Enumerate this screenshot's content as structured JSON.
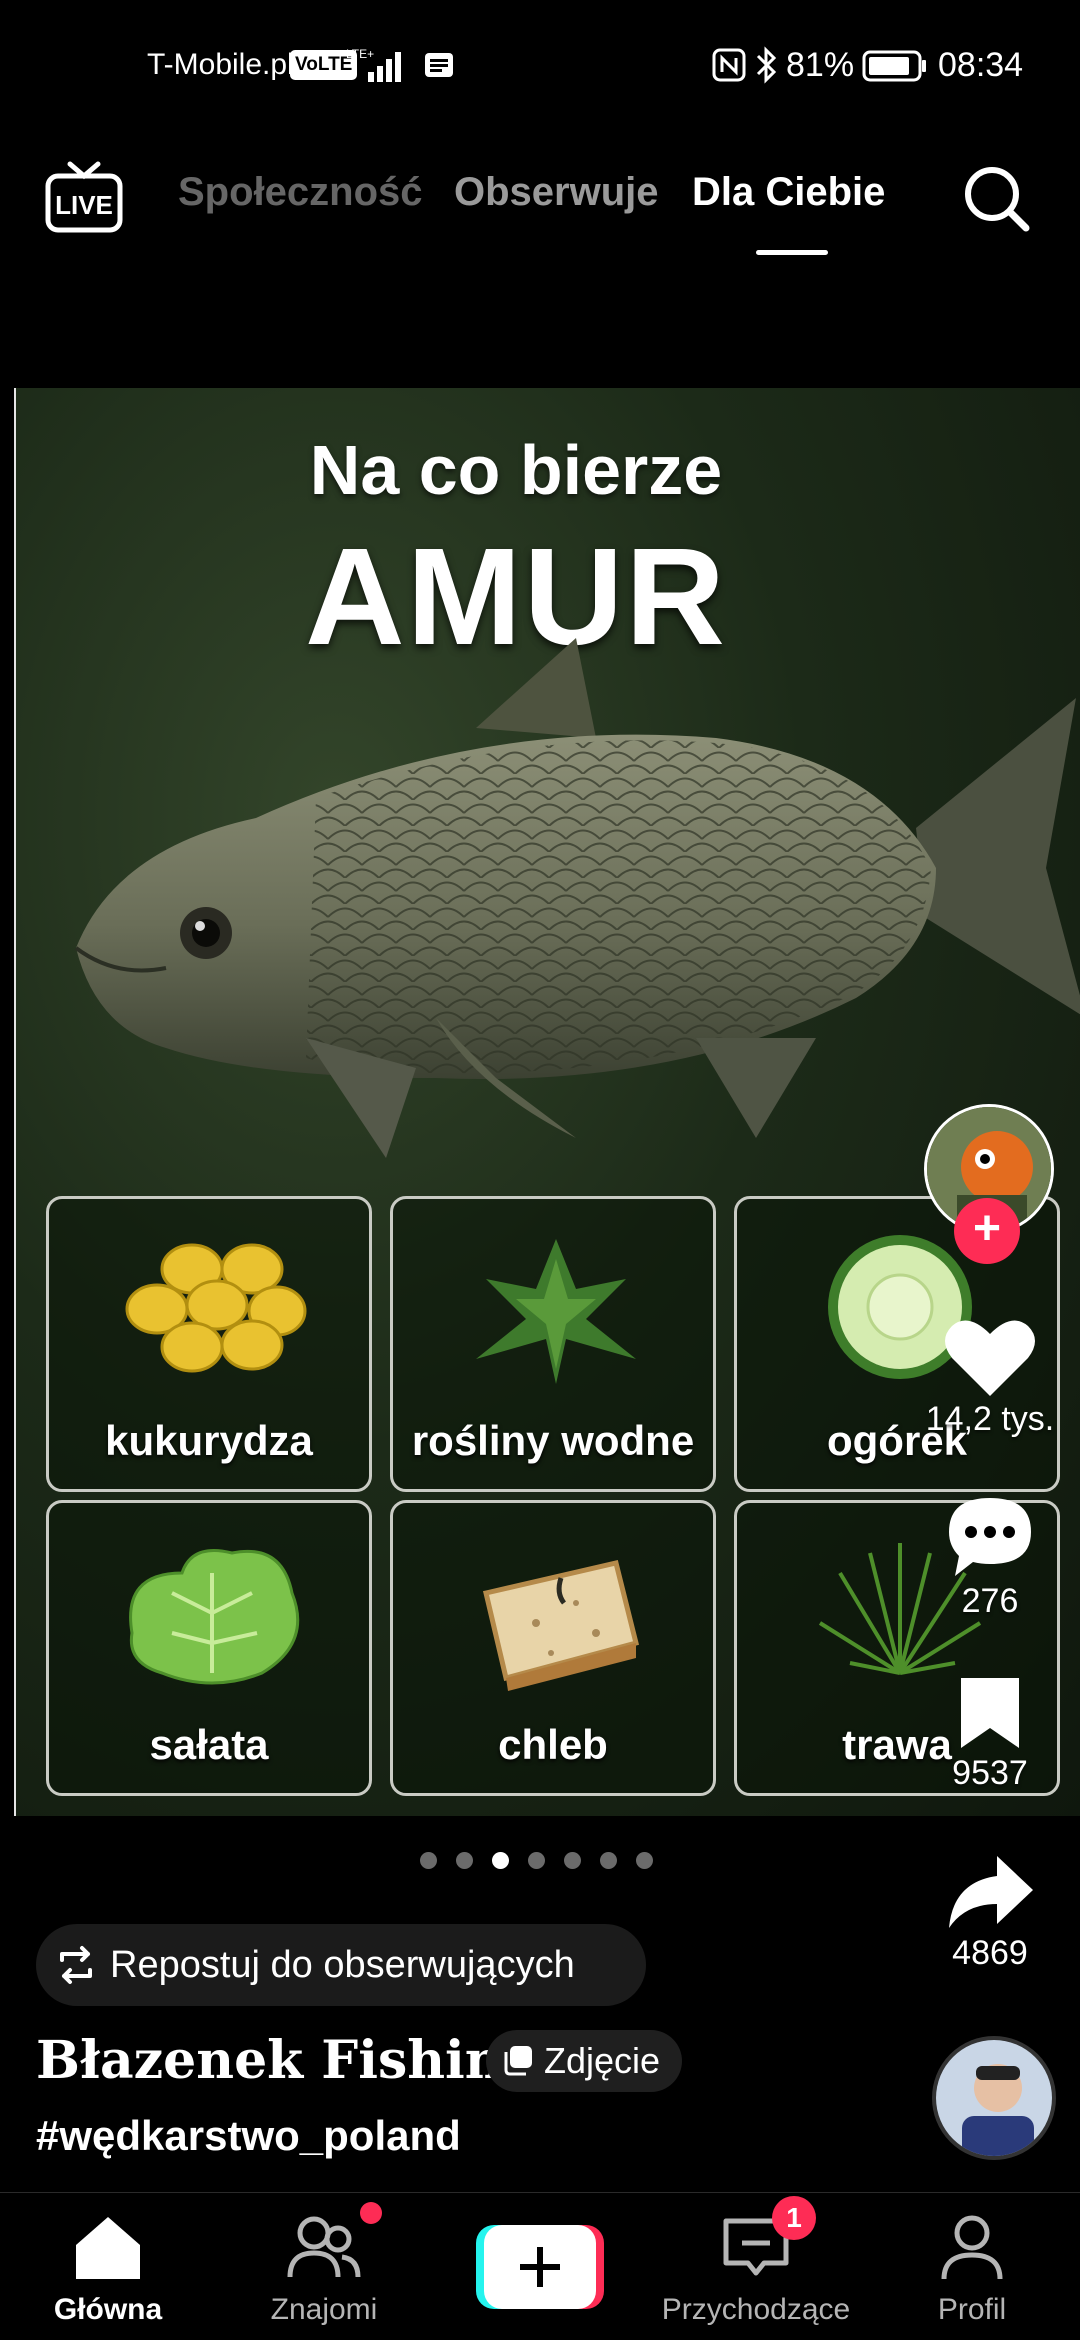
{
  "status_bar": {
    "carrier": "T-Mobile.pl",
    "volte": "VoLTE",
    "network": "LTE+",
    "battery": "81%",
    "time": "08:34"
  },
  "top_nav": {
    "tabs": [
      {
        "label": "Społeczność",
        "active": false
      },
      {
        "label": "Obserwuje",
        "active": false
      },
      {
        "label": "Dla Ciebie",
        "active": true
      }
    ]
  },
  "post": {
    "image": {
      "subtitle": "Na co bierze",
      "title": "AMUR",
      "baits": [
        {
          "label": "kukurydza",
          "icon": "corn-icon"
        },
        {
          "label": "rośliny wodne",
          "icon": "water-plants-icon"
        },
        {
          "label": "ogórek",
          "icon": "cucumber-icon"
        },
        {
          "label": "sałata",
          "icon": "lettuce-icon"
        },
        {
          "label": "chleb",
          "icon": "bread-icon"
        },
        {
          "label": "trawa",
          "icon": "grass-icon"
        }
      ]
    },
    "carousel": {
      "count": 7,
      "active_index": 2
    },
    "likes": "14,2 tys.",
    "comments": "276",
    "saves": "9537",
    "shares": "4869",
    "repost_label": "Repostuj do obserwujących",
    "author": "Błazenek Fishing",
    "badge": "Zdjęcie",
    "hashtag": "#wędkarstwo_poland"
  },
  "bottom_nav": {
    "items": [
      {
        "label": "Główna",
        "active": true
      },
      {
        "label": "Znajomi",
        "active": false
      },
      {
        "label": "",
        "active": false
      },
      {
        "label": "Przychodzące",
        "active": false
      },
      {
        "label": "Profil",
        "active": false
      }
    ],
    "inbox_badge": "1"
  },
  "colors": {
    "accent": "#fe2c55",
    "background": "#000000"
  }
}
